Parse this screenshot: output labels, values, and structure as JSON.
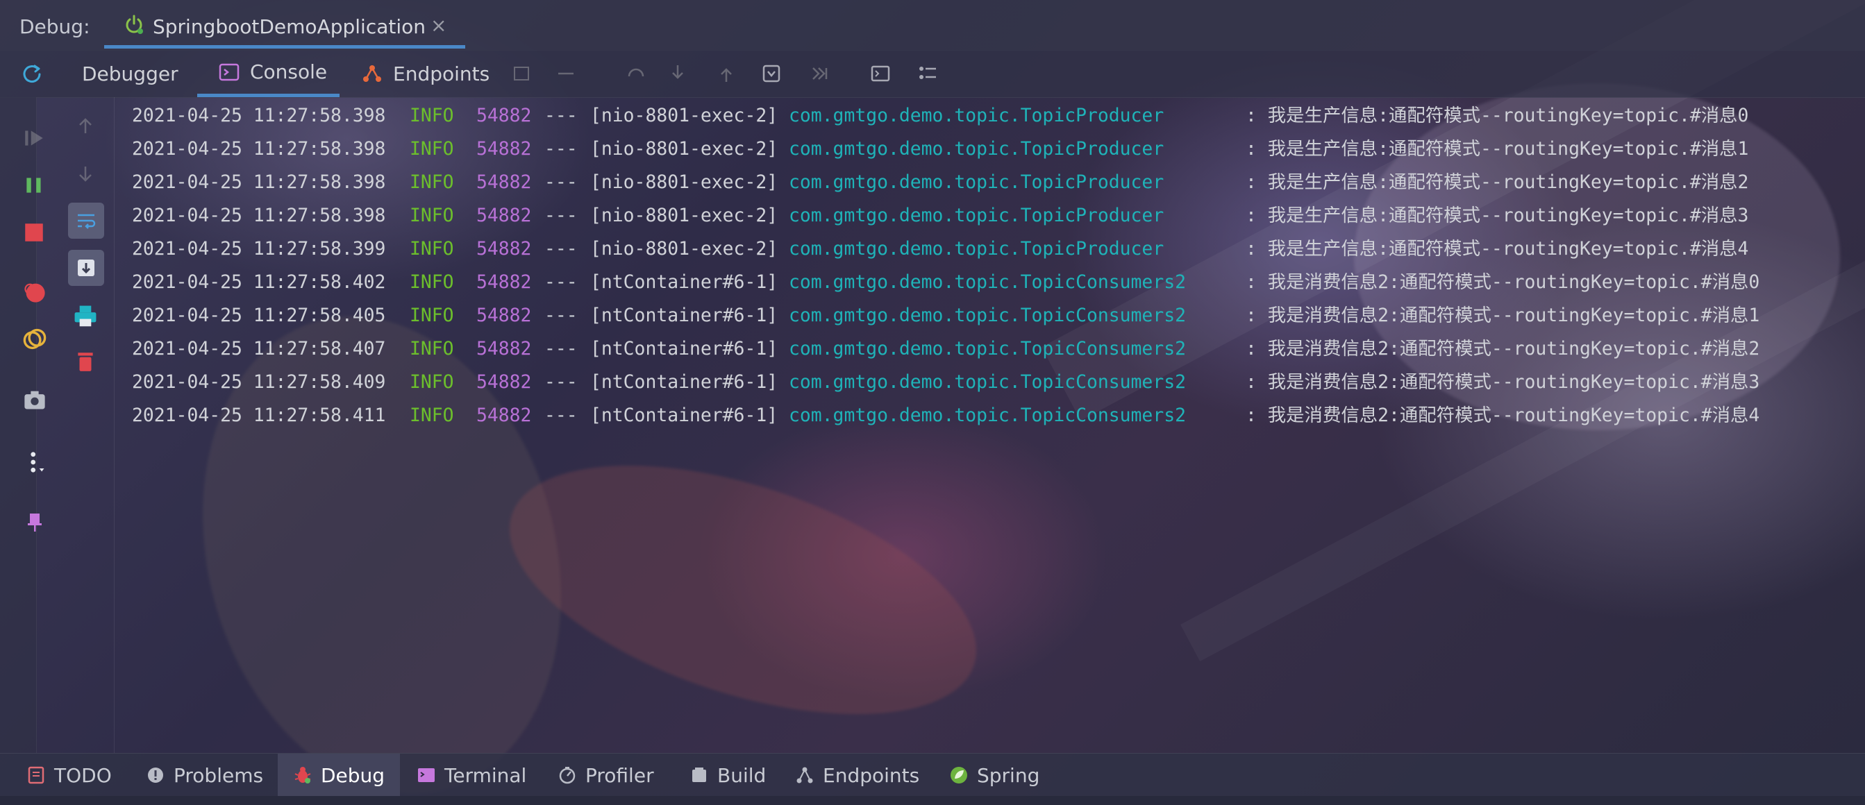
{
  "window": {
    "debug_label": "Debug:",
    "run_tab_name": "SpringbootDemoApplication",
    "close_glyph": "×"
  },
  "tabs": [
    {
      "label": "Debugger"
    },
    {
      "label": "Console"
    },
    {
      "label": "Endpoints"
    }
  ],
  "log": {
    "lines": [
      {
        "ts": "2021-04-25 11:27:58.398",
        "level": "INFO",
        "pid": "54882",
        "sep": "---",
        "thread": "[nio-8801-exec-2]",
        "logger": "com.gmtgo.demo.topic.TopicProducer",
        "msg": ": 我是生产信息:通配符模式--routingKey=topic.#消息0"
      },
      {
        "ts": "2021-04-25 11:27:58.398",
        "level": "INFO",
        "pid": "54882",
        "sep": "---",
        "thread": "[nio-8801-exec-2]",
        "logger": "com.gmtgo.demo.topic.TopicProducer",
        "msg": ": 我是生产信息:通配符模式--routingKey=topic.#消息1"
      },
      {
        "ts": "2021-04-25 11:27:58.398",
        "level": "INFO",
        "pid": "54882",
        "sep": "---",
        "thread": "[nio-8801-exec-2]",
        "logger": "com.gmtgo.demo.topic.TopicProducer",
        "msg": ": 我是生产信息:通配符模式--routingKey=topic.#消息2"
      },
      {
        "ts": "2021-04-25 11:27:58.398",
        "level": "INFO",
        "pid": "54882",
        "sep": "---",
        "thread": "[nio-8801-exec-2]",
        "logger": "com.gmtgo.demo.topic.TopicProducer",
        "msg": ": 我是生产信息:通配符模式--routingKey=topic.#消息3"
      },
      {
        "ts": "2021-04-25 11:27:58.399",
        "level": "INFO",
        "pid": "54882",
        "sep": "---",
        "thread": "[nio-8801-exec-2]",
        "logger": "com.gmtgo.demo.topic.TopicProducer",
        "msg": ": 我是生产信息:通配符模式--routingKey=topic.#消息4"
      },
      {
        "ts": "2021-04-25 11:27:58.402",
        "level": "INFO",
        "pid": "54882",
        "sep": "---",
        "thread": "[ntContainer#6-1]",
        "logger": "com.gmtgo.demo.topic.TopicConsumers2",
        "msg": ": 我是消费信息2:通配符模式--routingKey=topic.#消息0"
      },
      {
        "ts": "2021-04-25 11:27:58.405",
        "level": "INFO",
        "pid": "54882",
        "sep": "---",
        "thread": "[ntContainer#6-1]",
        "logger": "com.gmtgo.demo.topic.TopicConsumers2",
        "msg": ": 我是消费信息2:通配符模式--routingKey=topic.#消息1"
      },
      {
        "ts": "2021-04-25 11:27:58.407",
        "level": "INFO",
        "pid": "54882",
        "sep": "---",
        "thread": "[ntContainer#6-1]",
        "logger": "com.gmtgo.demo.topic.TopicConsumers2",
        "msg": ": 我是消费信息2:通配符模式--routingKey=topic.#消息2"
      },
      {
        "ts": "2021-04-25 11:27:58.409",
        "level": "INFO",
        "pid": "54882",
        "sep": "---",
        "thread": "[ntContainer#6-1]",
        "logger": "com.gmtgo.demo.topic.TopicConsumers2",
        "msg": ": 我是消费信息2:通配符模式--routingKey=topic.#消息3"
      },
      {
        "ts": "2021-04-25 11:27:58.411",
        "level": "INFO",
        "pid": "54882",
        "sep": "---",
        "thread": "[ntContainer#6-1]",
        "logger": "com.gmtgo.demo.topic.TopicConsumers2",
        "msg": ": 我是消费信息2:通配符模式--routingKey=topic.#消息4"
      }
    ]
  },
  "bottom_tools": [
    {
      "label": "TODO"
    },
    {
      "label": "Problems"
    },
    {
      "label": "Debug"
    },
    {
      "label": "Terminal"
    },
    {
      "label": "Profiler"
    },
    {
      "label": "Build"
    },
    {
      "label": "Endpoints"
    },
    {
      "label": "Spring"
    }
  ],
  "colors": {
    "accent": "#4a88c7",
    "info": "#6cbf2c",
    "pid": "#b871d6",
    "logger": "#1fb3b8",
    "stop": "#e0464e"
  }
}
